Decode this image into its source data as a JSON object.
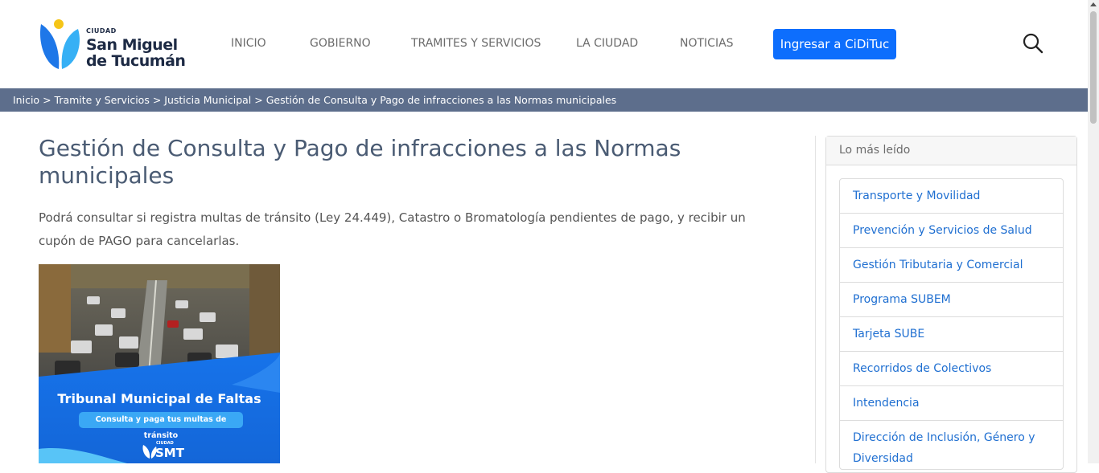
{
  "header": {
    "logo": {
      "small": "CIUDAD",
      "line1": "San Miguel",
      "line2": "de Tucumán"
    },
    "nav": [
      {
        "label": "INICIO"
      },
      {
        "label": "GOBIERNO"
      },
      {
        "label": "TRAMITES Y SERVICIOS"
      },
      {
        "label": "LA CIUDAD"
      },
      {
        "label": "NOTICIAS"
      }
    ],
    "cta_label": "Ingresar a CiDiTuc",
    "search_icon": "search-icon"
  },
  "breadcrumb": {
    "items": [
      "Inicio",
      "Tramite y Servicios",
      "Justicia Municipal"
    ],
    "current": "Gestión de Consulta y Pago de infracciones a las Normas municipales",
    "separator": ">"
  },
  "main": {
    "title": "Gestión de Consulta y Pago de infracciones a las Normas municipales",
    "description": "Podrá consultar si registra multas de tránsito (Ley 24.449), Catastro o Bromatología pendientes de pago, y recibir un cupón de PAGO para cancelarlas.",
    "banner": {
      "title": "Tribunal Municipal de Faltas",
      "subtitle": "Consulta y paga tus multas de tránsito",
      "logo_small": "CIUDAD",
      "logo_text": "SMT"
    }
  },
  "sidebar": {
    "heading": "Lo más leído",
    "items": [
      {
        "label": "Transporte y Movilidad"
      },
      {
        "label": "Prevención y Servicios de Salud"
      },
      {
        "label": "Gestión Tributaria y Comercial"
      },
      {
        "label": "Programa SUBEM"
      },
      {
        "label": "Tarjeta SUBE"
      },
      {
        "label": "Recorridos de Colectivos"
      },
      {
        "label": "Intendencia"
      },
      {
        "label": "Dirección de Inclusión, Género y Diversidad"
      }
    ]
  },
  "colors": {
    "primary": "#0d6efd",
    "breadcrumb_bg": "#5d6e8c",
    "title": "#4a5b73",
    "link": "#1f6fd1"
  }
}
